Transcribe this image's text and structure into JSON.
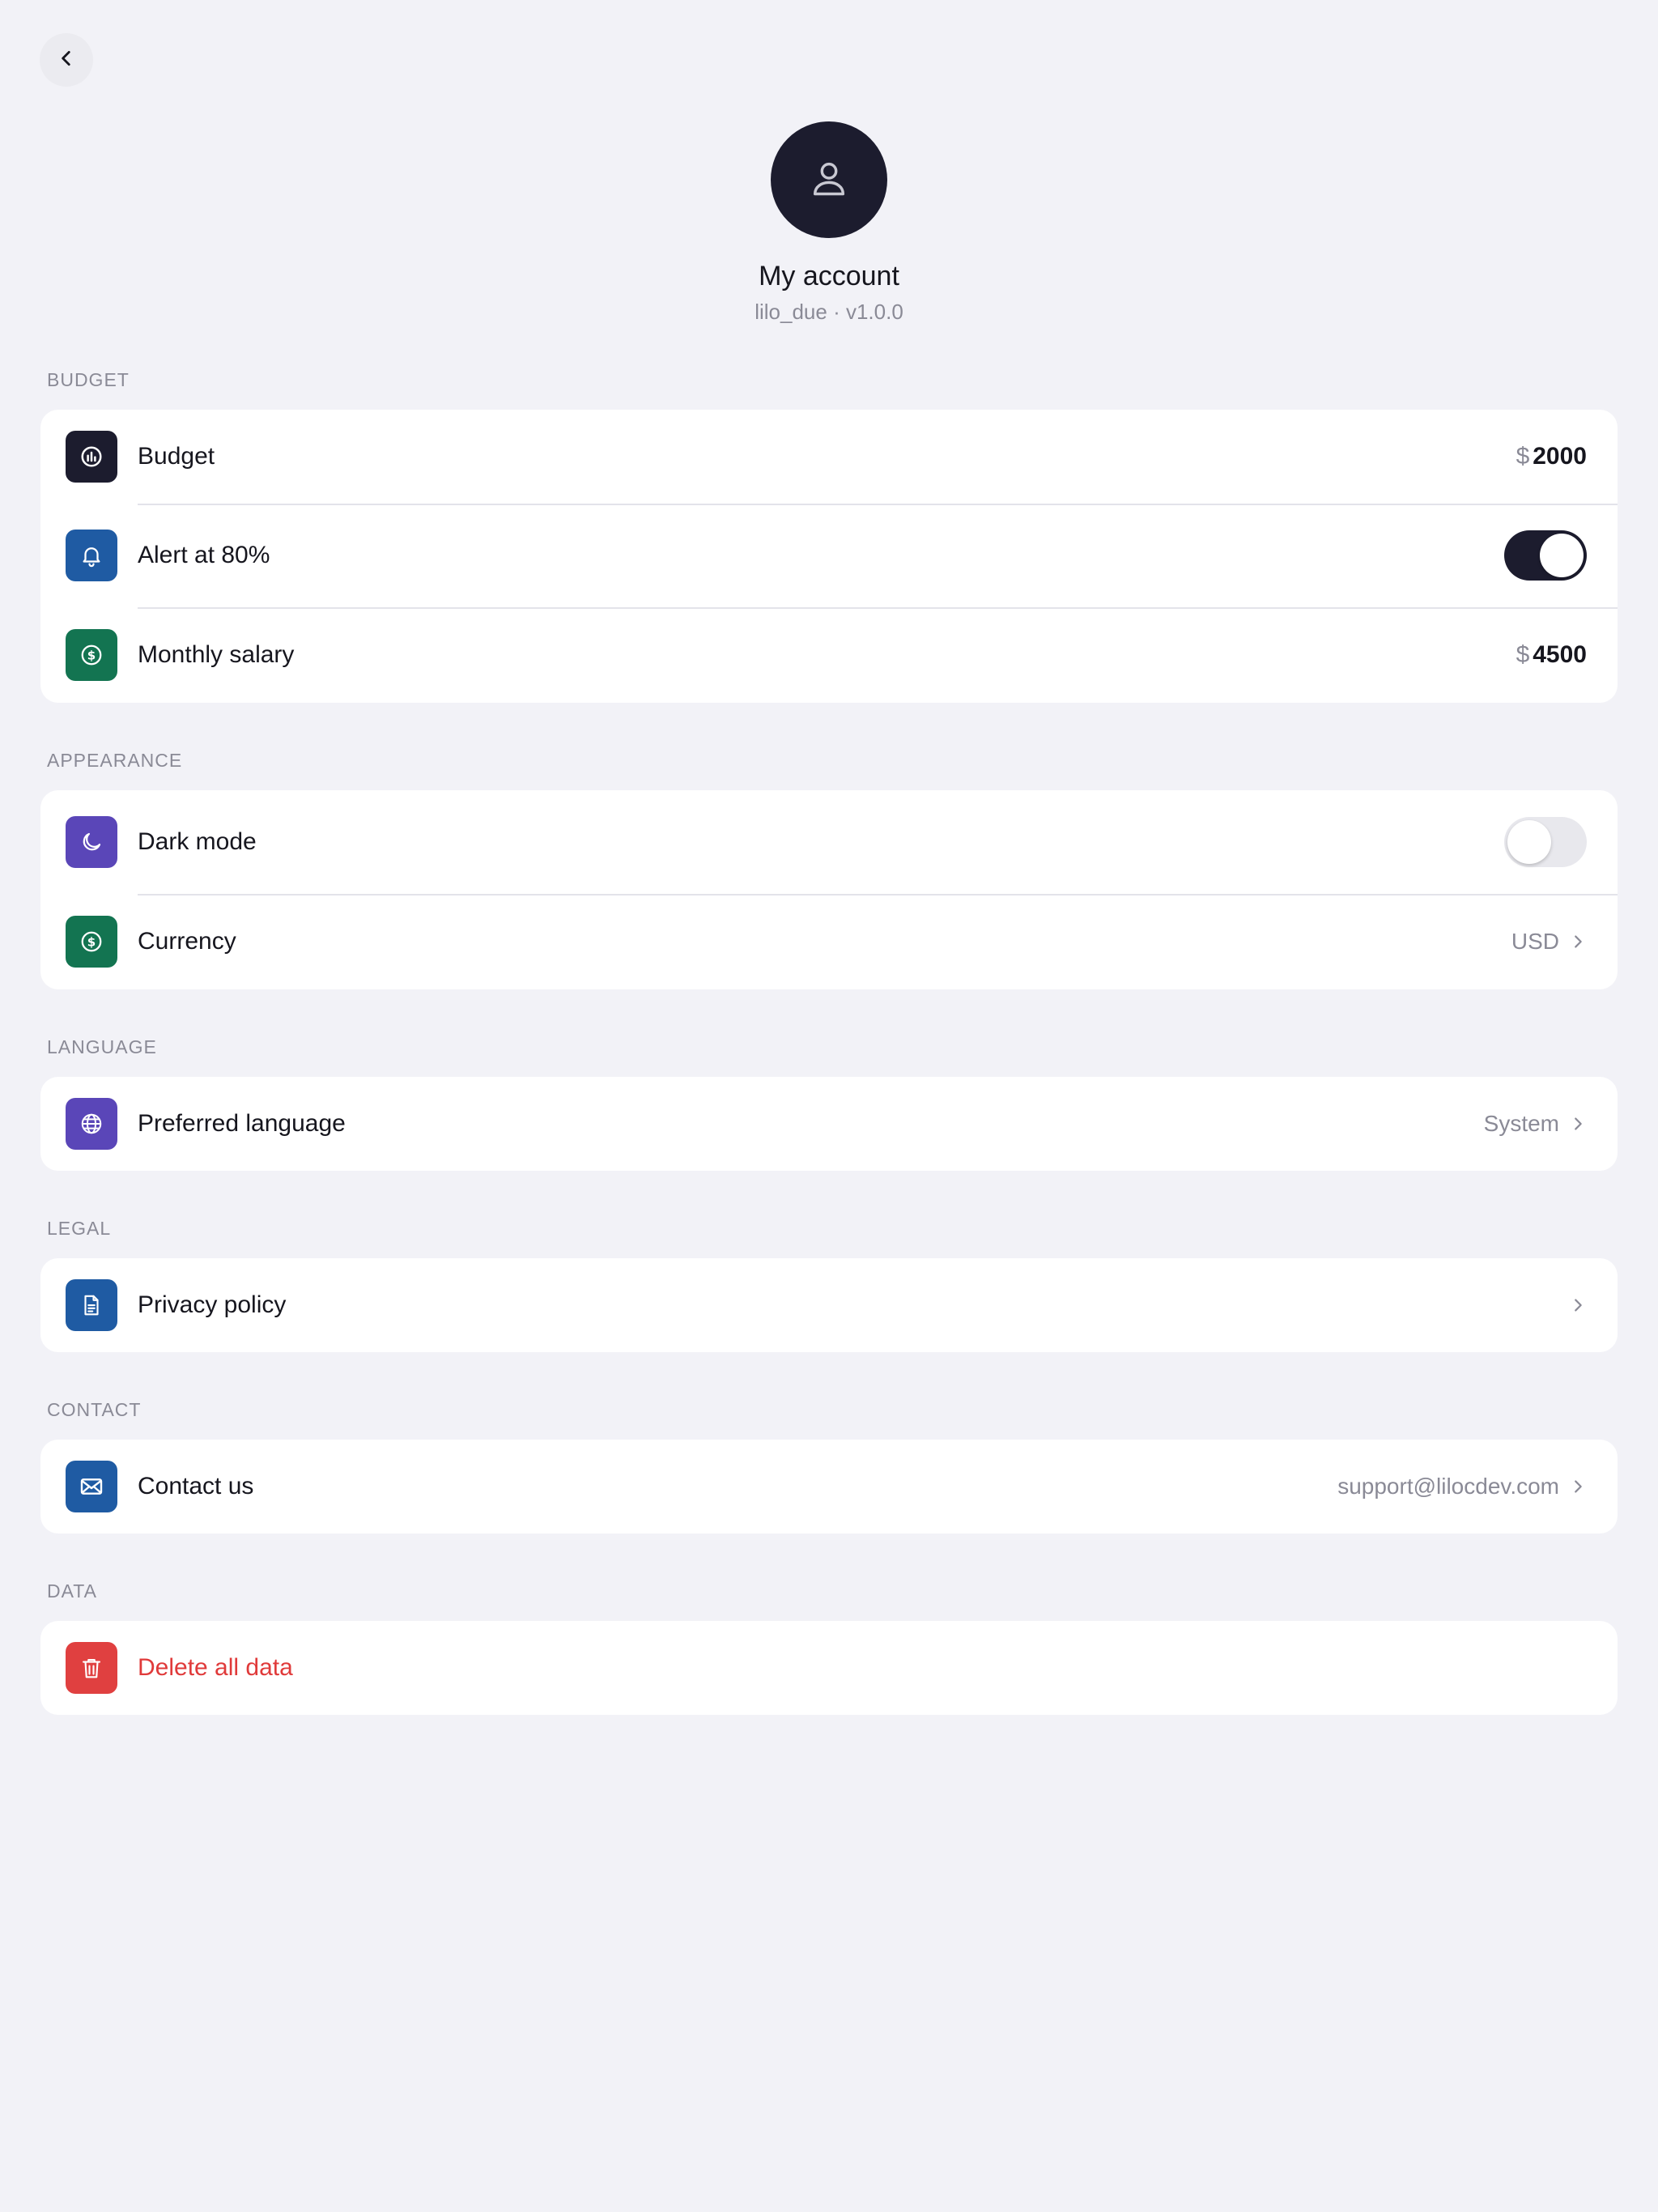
{
  "header": {
    "title": "My account",
    "subtitle": "lilo_due · v1.0.0"
  },
  "icons": {
    "back": "chevron-left-icon",
    "avatar": "person-icon"
  },
  "colors": {
    "background": "#f2f2f7",
    "dark": "#1c1c2e",
    "blue": "#1f5ba3",
    "green": "#137451",
    "purple": "#5a46b8",
    "red": "#e04040",
    "danger_text": "#e03a3a"
  },
  "sections": {
    "budget": {
      "label": "BUDGET",
      "rows": {
        "budget": {
          "label": "Budget",
          "currency": "$",
          "amount": "2000",
          "icon": "budget-chart-icon"
        },
        "alert": {
          "label": "Alert at 80%",
          "toggle_on": true,
          "icon": "bell-icon"
        },
        "salary": {
          "label": "Monthly salary",
          "currency": "$",
          "amount": "4500",
          "icon": "dollar-icon"
        }
      }
    },
    "appearance": {
      "label": "APPEARANCE",
      "rows": {
        "dark_mode": {
          "label": "Dark mode",
          "toggle_on": false,
          "icon": "moon-icon"
        },
        "currency": {
          "label": "Currency",
          "value": "USD",
          "icon": "dollar-icon"
        }
      }
    },
    "language": {
      "label": "LANGUAGE",
      "rows": {
        "preferred": {
          "label": "Preferred language",
          "value": "System",
          "icon": "globe-icon"
        }
      }
    },
    "legal": {
      "label": "LEGAL",
      "rows": {
        "privacy": {
          "label": "Privacy policy",
          "icon": "document-icon"
        }
      }
    },
    "contact": {
      "label": "CONTACT",
      "rows": {
        "contact": {
          "label": "Contact us",
          "value": "support@lilocdev.com",
          "icon": "mail-icon"
        }
      }
    },
    "data": {
      "label": "DATA",
      "rows": {
        "delete": {
          "label": "Delete all data",
          "icon": "trash-icon"
        }
      }
    }
  }
}
